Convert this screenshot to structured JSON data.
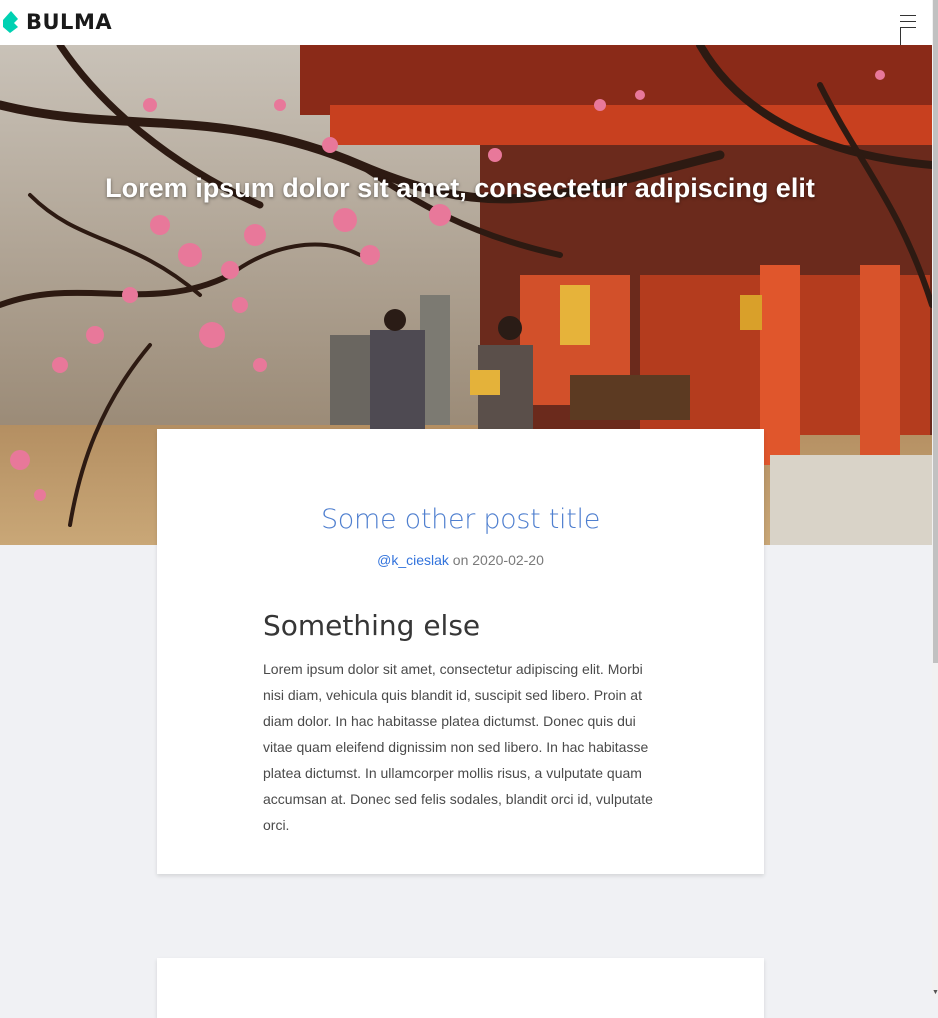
{
  "navbar": {
    "brand": "BULMA",
    "brand_color": "#00d1b2",
    "menu_icon": "hamburger-menu-icon"
  },
  "hero": {
    "title": "Lorem ipsum dolor sit amet, consectetur adipiscing elit",
    "image": "japanese-temple-plum-blossoms-photo"
  },
  "post": {
    "title": "Some other post title",
    "author": "@k_cieslak",
    "date_prefix": "on",
    "date": "2020-02-20",
    "heading": "Something else",
    "body": "Lorem ipsum dolor sit amet, consectetur adipiscing elit. Morbi nisi diam, vehicula quis blandit id, suscipit sed libero. Proin at diam dolor. In hac habitasse platea dictumst. Donec quis dui vitae quam eleifend dignissim non sed libero. In hac habitasse platea dictumst. In ullamcorper mollis risus, a vulputate quam accumsan at. Donec sed felis sodales, blandit orci id, vulputate orci."
  },
  "colors": {
    "link": "#3273dc",
    "title": "#4f7fcf",
    "background": "#f0f1f4"
  }
}
